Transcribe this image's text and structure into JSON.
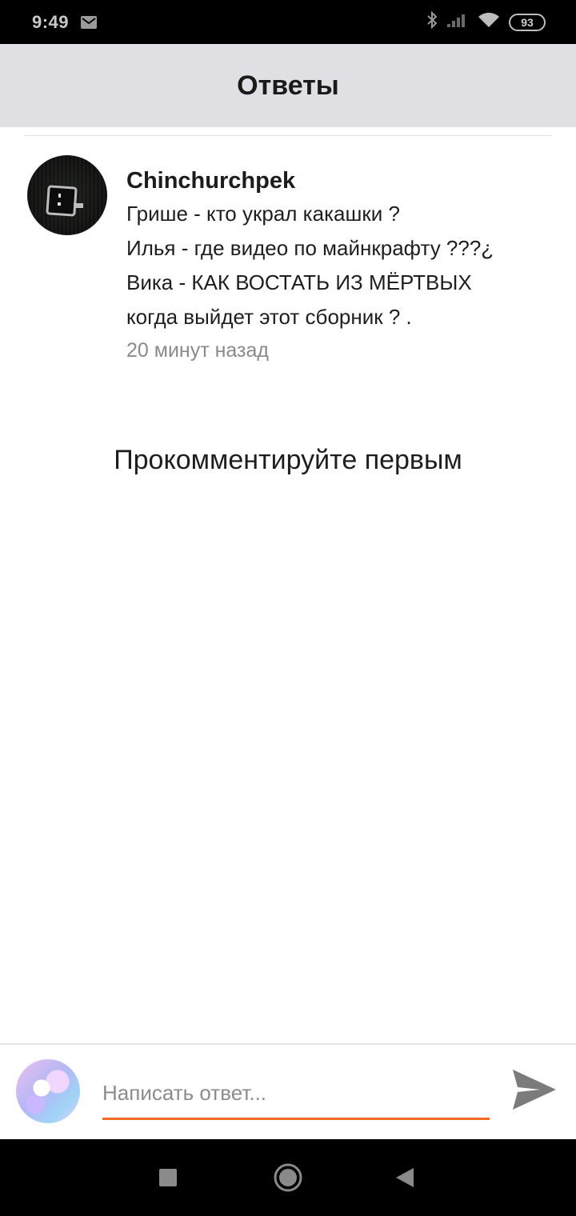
{
  "status_bar": {
    "time": "9:49",
    "battery": "93",
    "icons": [
      "mail-icon",
      "bluetooth-icon",
      "signal-icon",
      "wifi-icon",
      "battery-icon"
    ]
  },
  "header": {
    "title": "Ответы"
  },
  "comment": {
    "author": "Chinchurchpek",
    "lines": [
      "Грише - кто украл какашки ?",
      "Илья - где видео по майнкрафту ???¿",
      "Вика - КАК ВОСТАТЬ ИЗ МЁРТВЫХ",
      "когда выйдет этот сборник ? ."
    ],
    "time": "20 минут назад"
  },
  "empty_state": {
    "text": "Прокомментируйте первым"
  },
  "composer": {
    "placeholder": "Написать ответ...",
    "accent_color": "#f26a21",
    "send_icon": "send-icon"
  },
  "nav_bar": {
    "icons": [
      "recents-icon",
      "home-icon",
      "back-icon"
    ]
  }
}
